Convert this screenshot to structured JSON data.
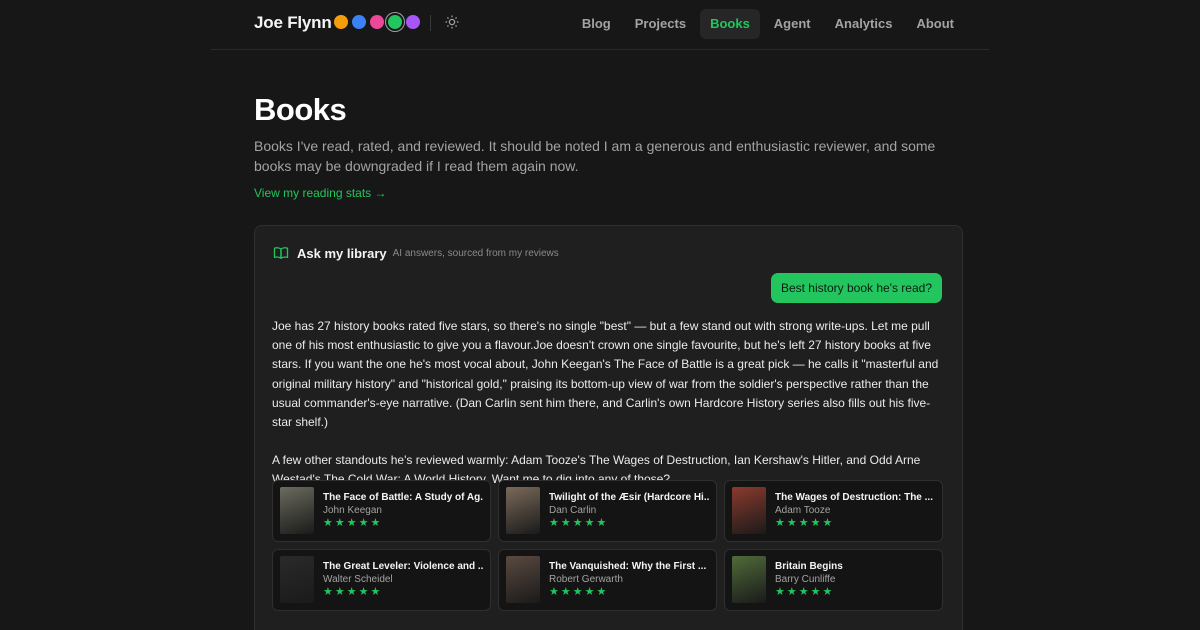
{
  "site": {
    "title": "Joe Flynn"
  },
  "theme_swatches": [
    {
      "color": "#f59e0b",
      "active": false
    },
    {
      "color": "#3b82f6",
      "active": false
    },
    {
      "color": "#ec4899",
      "active": false
    },
    {
      "color": "#22c55e",
      "active": true
    },
    {
      "color": "#a855f7",
      "active": false
    }
  ],
  "theme_toggle_icon": "sun-icon",
  "nav": [
    {
      "label": "Blog",
      "active": false
    },
    {
      "label": "Projects",
      "active": false
    },
    {
      "label": "Books",
      "active": true
    },
    {
      "label": "Agent",
      "active": false
    },
    {
      "label": "Analytics",
      "active": false
    },
    {
      "label": "About",
      "active": false
    }
  ],
  "page": {
    "title": "Books",
    "description": "Books I've read, rated, and reviewed. It should be noted I am a generous and enthusiastic reviewer, and some books may be downgraded if I read them again now.",
    "stats_link": "View my reading stats →"
  },
  "chat": {
    "icon": "open-book-icon",
    "title": "Ask my library",
    "subtitle": "AI answers, sourced from my reviews",
    "user_message": "Best history book he's read?",
    "answer_paragraphs": [
      "Joe has 27 history books rated five stars, so there's no single \"best\" — but a few stand out with strong write-ups. Let me pull one of his most enthusiastic to give you a flavour.Joe doesn't crown one single favourite, but he's left 27 history books at five stars. If you want the one he's most vocal about, John Keegan's The Face of Battle is a great pick — he calls it \"masterful and original military history\" and \"historical gold,\" praising its bottom-up view of war from the soldier's perspective rather than the usual commander's-eye narrative. (Dan Carlin sent him there, and Carlin's own Hardcore History series also fills out his five-star shelf.)",
      "A few other standouts he's reviewed warmly: Adam Tooze's The Wages of Destruction, Ian Kershaw's Hitler, and Odd Arne Westad's The Cold War: A World History. Want me to dig into any of those?"
    ],
    "books": [
      {
        "title": "The Face of Battle: A Study of Ag...",
        "author": "John Keegan",
        "stars": "★★★★★",
        "rating": 5,
        "cover_color": "#6b6b5e"
      },
      {
        "title": "Twilight of the Æsir (Hardcore Hi...",
        "author": "Dan Carlin",
        "stars": "★★★★★",
        "rating": 5,
        "cover_color": "#7a6a5a"
      },
      {
        "title": "The Wages of Destruction: The ...",
        "author": "Adam Tooze",
        "stars": "★★★★★",
        "rating": 5,
        "cover_color": "#8b3a2e"
      },
      {
        "title": "The Great Leveler: Violence and ...",
        "author": "Walter Scheidel",
        "stars": "★★★★★",
        "rating": 5,
        "cover_color": "#2a2a2a"
      },
      {
        "title": "The Vanquished: Why the First ...",
        "author": "Robert Gerwarth",
        "stars": "★★★★★",
        "rating": 5,
        "cover_color": "#5a4a40"
      },
      {
        "title": "Britain Begins",
        "author": "Barry Cunliffe",
        "stars": "★★★★★",
        "rating": 5,
        "cover_color": "#4f6b3a"
      }
    ]
  }
}
